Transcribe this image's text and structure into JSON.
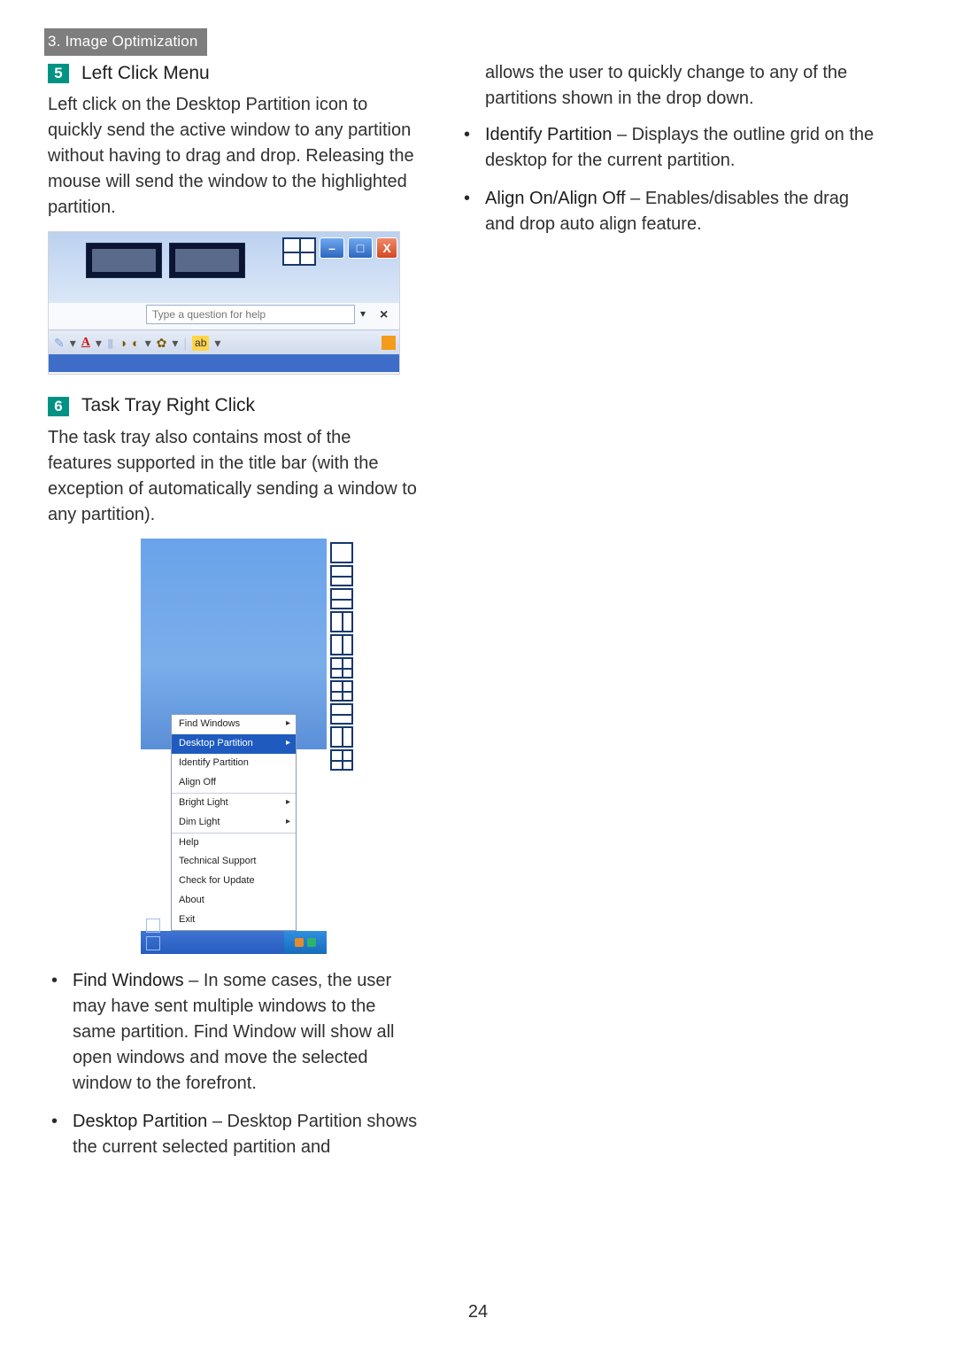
{
  "breadcrumb": "3. Image Optimization",
  "page_number": "24",
  "left": {
    "step5": {
      "num": "5",
      "title": "Left Click Menu"
    },
    "p1": "Left click on the Desktop Partition icon to quickly send the active window to any partition without having to drag and drop. Releasing the mouse will send the window to the highlighted partition.",
    "step6": {
      "num": "6",
      "title": "Task Tray Right Click"
    },
    "p2": "The task tray also contains most of the features supported in the title bar (with the exception of automatically sending a window to any partition).",
    "bullets": [
      {
        "term": "Find Windows",
        "text": " – In some cases, the user may have sent multiple windows to the same partition. Find Window will show all open windows and move the selected window to the forefront."
      },
      {
        "term": "Desktop Partition",
        "text": " – Desktop Partition shows the current selected partition and"
      }
    ]
  },
  "right": {
    "cont": "allows the user to quickly change to any of the partitions shown in the drop down.",
    "bullets": [
      {
        "term": "Identify Partition",
        "text": " – Displays the outline grid on the desktop for the current partition."
      },
      {
        "term": "Align On/Align Off",
        "text": " – Enables/disables the drag and drop auto align feature."
      }
    ]
  },
  "shot1": {
    "help_placeholder": "Type a question for help",
    "btn_min": "–",
    "btn_max": "□",
    "btn_close": "X",
    "drop": "▾",
    "xhelp": "×",
    "A": "A",
    "ab": "ab",
    "status": "           "
  },
  "shot2_menu": {
    "g1": [
      {
        "label": "Find Windows",
        "sub": true
      },
      {
        "label": "Desktop Partition",
        "sub": true,
        "selected": true
      },
      {
        "label": "Identify Partition"
      },
      {
        "label": "Align Off"
      }
    ],
    "g2": [
      {
        "label": "Bright Light",
        "sub": true
      },
      {
        "label": "Dim Light",
        "sub": true
      }
    ],
    "g3": [
      {
        "label": "Help"
      },
      {
        "label": "Technical Support"
      },
      {
        "label": "Check for Update"
      },
      {
        "label": "About"
      },
      {
        "label": "Exit"
      }
    ]
  }
}
